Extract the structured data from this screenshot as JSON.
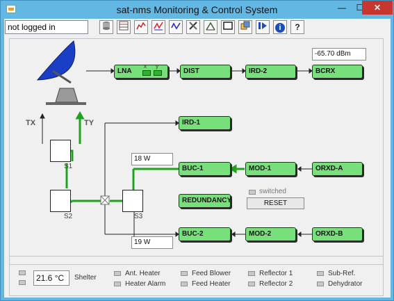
{
  "window": {
    "title": "sat-nms Monitoring & Control System",
    "close_glyph": "✕",
    "min_glyph": "—",
    "max_glyph": "☐"
  },
  "login_status": "not logged in",
  "toolbar": {
    "icons": [
      "database-icon",
      "table-icon",
      "chart-icon",
      "chart-red-icon",
      "chart-blue-icon",
      "tools-icon",
      "schematic-icon",
      "window-icon",
      "layers-icon",
      "play-icon",
      "info-icon",
      "help-icon"
    ],
    "help_glyph": "?",
    "info_glyph": "i"
  },
  "chain": {
    "lna": "LNA",
    "lna_x": "x",
    "lna_y": "y",
    "dist": "DIST",
    "ird2": "IRD-2",
    "bcrx": "BCRX",
    "bcrx_level": "-65.70 dBm",
    "ird1": "IRD-1",
    "buc1": "BUC-1",
    "buc1_power": "18 W",
    "mod1": "MOD-1",
    "orxda": "ORXD-A",
    "redundancy": "REDUNDANCY",
    "switched": "switched",
    "reset": "RESET",
    "buc2": "BUC-2",
    "buc2_power": "19 W",
    "mod2": "MOD-2",
    "orxdb": "ORXD-B",
    "tx": "TX",
    "ty": "TY",
    "s1": "S1",
    "s2": "S2",
    "s3": "S3"
  },
  "status": {
    "temperature": "21.6 °C",
    "shelter": "Shelter",
    "ant_heater": "Ant. Heater",
    "heater_alarm": "Heater Alarm",
    "feed_blower": "Feed Blower",
    "feed_heater": "Feed Heater",
    "reflector1": "Reflector 1",
    "reflector2": "Reflector 2",
    "subref": "Sub-Ref.",
    "dehydrator": "Dehydrator"
  },
  "colors": {
    "block": "#78e07b",
    "signal": "#1fa31f",
    "titlebar": "#63b7e3",
    "close": "#c7372f"
  }
}
